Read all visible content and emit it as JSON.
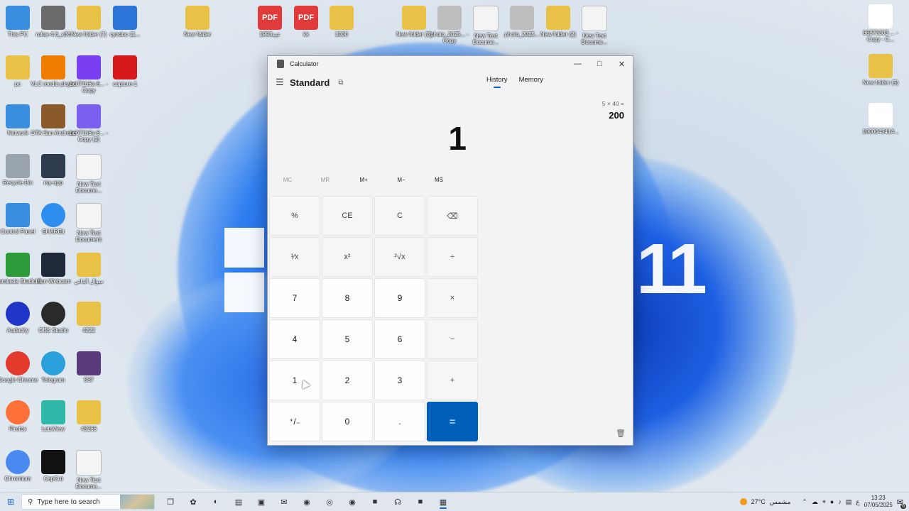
{
  "desktop": {
    "left_icons": [
      {
        "label": "This PC",
        "icon": "this-pc-icon",
        "color": "#3a8ee0",
        "col": 0,
        "row": 0
      },
      {
        "label": "rufus-4.6_x86",
        "icon": "usb-drive-icon",
        "color": "#6b6b6b",
        "col": 1,
        "row": 0
      },
      {
        "label": "New folder (7)",
        "icon": "folder-icon",
        "color": "#e8c146",
        "col": 2,
        "row": 0
      },
      {
        "label": "cyndoc-11...",
        "icon": "app-icon",
        "color": "#2b74d8",
        "col": 3,
        "row": 0
      },
      {
        "label": "pc",
        "icon": "user-folder-icon",
        "color": "#e8c146",
        "col": 0,
        "row": 1
      },
      {
        "label": "VLC media player",
        "icon": "vlc-icon",
        "color": "#ef7d00",
        "col": 1,
        "row": 1
      },
      {
        "label": "bc071b6a-6... - Copy",
        "icon": "image-icon",
        "color": "#7a3ff0",
        "col": 2,
        "row": 1
      },
      {
        "label": "capture-1",
        "icon": "video-icon",
        "color": "#d61a1a",
        "col": 3,
        "row": 1
      },
      {
        "label": "Network",
        "icon": "network-icon",
        "color": "#3a8ee0",
        "col": 0,
        "row": 2
      },
      {
        "label": "GTA San Andreas",
        "icon": "game-icon",
        "color": "#8a5a2c",
        "col": 1,
        "row": 2
      },
      {
        "label": "bc071b6a-6... - Copy (2)",
        "icon": "image-icon",
        "color": "#7a5ff0",
        "col": 2,
        "row": 2
      },
      {
        "label": "Recycle Bin",
        "icon": "recycle-bin-icon",
        "color": "#9aa4ad",
        "col": 0,
        "row": 3
      },
      {
        "label": "my-app",
        "icon": "electron-icon",
        "color": "#2e3b4e",
        "col": 1,
        "row": 3
      },
      {
        "label": "New Text Docume...",
        "icon": "text-file-icon",
        "color": "#f4f4f4",
        "col": 2,
        "row": 3
      },
      {
        "label": "Control Panel",
        "icon": "control-panel-icon",
        "color": "#3a8ee0",
        "col": 0,
        "row": 4
      },
      {
        "label": "SHAREit",
        "icon": "shareit-icon",
        "color": "#2e8ef0",
        "col": 1,
        "row": 4
      },
      {
        "label": "New Text Document",
        "icon": "text-file-icon",
        "color": "#f4f4f4",
        "col": 2,
        "row": 4
      },
      {
        "label": "Camtasia Studio 8",
        "icon": "camtasia-icon",
        "color": "#2e9b3a",
        "col": 0,
        "row": 5
      },
      {
        "label": "Iriun Webcam",
        "icon": "webcam-icon",
        "color": "#1e2a3a",
        "col": 1,
        "row": 5
      },
      {
        "label": "سوال الذاتي",
        "icon": "folder-icon",
        "color": "#e8c146",
        "col": 2,
        "row": 5
      },
      {
        "label": "Audacity",
        "icon": "audacity-icon",
        "color": "#2036c9",
        "col": 0,
        "row": 6
      },
      {
        "label": "OBS Studio",
        "icon": "obs-icon",
        "color": "#2a2a2a",
        "col": 1,
        "row": 6
      },
      {
        "label": "4222",
        "icon": "folder-icon",
        "color": "#e8c146",
        "col": 2,
        "row": 6
      },
      {
        "label": "Google Chrome",
        "icon": "chrome-icon",
        "color": "#e23b2e",
        "col": 0,
        "row": 7
      },
      {
        "label": "Telegram",
        "icon": "telegram-icon",
        "color": "#2aa1da",
        "col": 1,
        "row": 7
      },
      {
        "label": "587",
        "icon": "image-icon",
        "color": "#5a3a7a",
        "col": 2,
        "row": 7
      },
      {
        "label": "Firefox",
        "icon": "firefox-icon",
        "color": "#ff7139",
        "col": 0,
        "row": 8
      },
      {
        "label": "LetsView",
        "icon": "letsview-icon",
        "color": "#2fb8a8",
        "col": 1,
        "row": 8
      },
      {
        "label": "45266",
        "icon": "folder-icon",
        "color": "#e8c146",
        "col": 2,
        "row": 8
      },
      {
        "label": "Chromium",
        "icon": "chromium-icon",
        "color": "#4a8af0",
        "col": 0,
        "row": 9
      },
      {
        "label": "CapCut",
        "icon": "capcut-icon",
        "color": "#111111",
        "col": 1,
        "row": 9
      },
      {
        "label": "New Text Docume...",
        "icon": "text-file-icon",
        "color": "#f4f4f4",
        "col": 2,
        "row": 9
      }
    ],
    "top_icons": [
      {
        "label": "New folder",
        "icon": "folder-icon",
        "color": "#e8c146"
      },
      {
        "label": "1993عبد",
        "icon": "pdf-icon",
        "color": "#e03a3a"
      },
      {
        "label": "kk",
        "icon": "pdf-icon",
        "color": "#e03a3a"
      },
      {
        "label": "3030",
        "icon": "folder-icon",
        "color": "#e8c146"
      },
      {
        "label": "New folder (3)",
        "icon": "folder-icon",
        "color": "#e8c146"
      },
      {
        "label": "photo_2025... - Copy",
        "icon": "image-file-icon",
        "color": "#bdbdbd"
      },
      {
        "label": "New Text Docume...",
        "icon": "text-file-icon",
        "color": "#f4f4f4"
      },
      {
        "label": "photo_2025...",
        "icon": "image-file-icon",
        "color": "#bdbdbd"
      },
      {
        "label": "New folder (2)",
        "icon": "folder-icon",
        "color": "#e8c146"
      },
      {
        "label": "New Text Docume...",
        "icon": "text-file-icon",
        "color": "#f4f4f4"
      }
    ],
    "right_icons": [
      {
        "label": "86873303 ... - Copy - C...",
        "icon": "image-icon",
        "color": "#ffffff"
      },
      {
        "label": "New folder (5)",
        "icon": "folder-icon",
        "color": "#e8c146"
      },
      {
        "label": "1000043414...",
        "icon": "image-icon",
        "color": "#ffffff"
      }
    ],
    "wallpaper_text": "11"
  },
  "calculator": {
    "title": "Calculator",
    "mode": "Standard",
    "tabs": [
      "History",
      "Memory"
    ],
    "active_tab": "History",
    "display": "1",
    "history": {
      "expression": "5  ×  40 =",
      "result": "200"
    },
    "memory_buttons": [
      "MC",
      "MR",
      "M+",
      "M−",
      "MS"
    ],
    "keys": [
      {
        "label": "%",
        "type": "op",
        "name": "percent-button"
      },
      {
        "label": "CE",
        "type": "op",
        "name": "clear-entry-button"
      },
      {
        "label": "C",
        "type": "op",
        "name": "clear-button"
      },
      {
        "label": "⌫",
        "type": "op",
        "name": "backspace-button"
      },
      {
        "label": "¹⁄x",
        "type": "op",
        "name": "reciprocal-button"
      },
      {
        "label": "x²",
        "type": "op",
        "name": "square-button"
      },
      {
        "label": "²√x",
        "type": "op",
        "name": "square-root-button"
      },
      {
        "label": "÷",
        "type": "op",
        "name": "divide-button"
      },
      {
        "label": "7",
        "type": "num",
        "name": "digit-7-button"
      },
      {
        "label": "8",
        "type": "num",
        "name": "digit-8-button"
      },
      {
        "label": "9",
        "type": "num",
        "name": "digit-9-button"
      },
      {
        "label": "×",
        "type": "op",
        "name": "multiply-button"
      },
      {
        "label": "4",
        "type": "num",
        "name": "digit-4-button"
      },
      {
        "label": "5",
        "type": "num",
        "name": "digit-5-button"
      },
      {
        "label": "6",
        "type": "num",
        "name": "digit-6-button"
      },
      {
        "label": "−",
        "type": "op",
        "name": "subtract-button"
      },
      {
        "label": "1",
        "type": "num",
        "name": "digit-1-button"
      },
      {
        "label": "2",
        "type": "num",
        "name": "digit-2-button"
      },
      {
        "label": "3",
        "type": "num",
        "name": "digit-3-button"
      },
      {
        "label": "+",
        "type": "op",
        "name": "add-button"
      },
      {
        "label": "⁺/₋",
        "type": "num",
        "name": "negate-button"
      },
      {
        "label": "0",
        "type": "num",
        "name": "digit-0-button"
      },
      {
        "label": ".",
        "type": "num",
        "name": "decimal-button"
      },
      {
        "label": "=",
        "type": "eq",
        "name": "equals-button"
      }
    ],
    "accent": "#005fb8"
  },
  "taskbar": {
    "search_placeholder": "Type here to search",
    "apps": [
      {
        "icon": "task-view-icon",
        "active": false
      },
      {
        "icon": "copilot-icon",
        "active": false
      },
      {
        "icon": "edge-icon",
        "active": false
      },
      {
        "icon": "file-explorer-icon",
        "active": false
      },
      {
        "icon": "store-icon",
        "active": false
      },
      {
        "icon": "outlook-icon",
        "active": false
      },
      {
        "icon": "chromium-icon",
        "active": false
      },
      {
        "icon": "firefox-icon",
        "active": false
      },
      {
        "icon": "chrome-icon",
        "active": false
      },
      {
        "icon": "camtasia-icon",
        "active": false
      },
      {
        "icon": "audacity-icon",
        "active": false
      },
      {
        "icon": "camtasia-recorder-icon",
        "active": false
      },
      {
        "icon": "calculator-icon",
        "active": true
      }
    ],
    "weather": "27°C",
    "weather_desc": "مشمس",
    "lang": "ع",
    "time": "13:23",
    "date": "07/05/2025",
    "notifications": "6"
  }
}
